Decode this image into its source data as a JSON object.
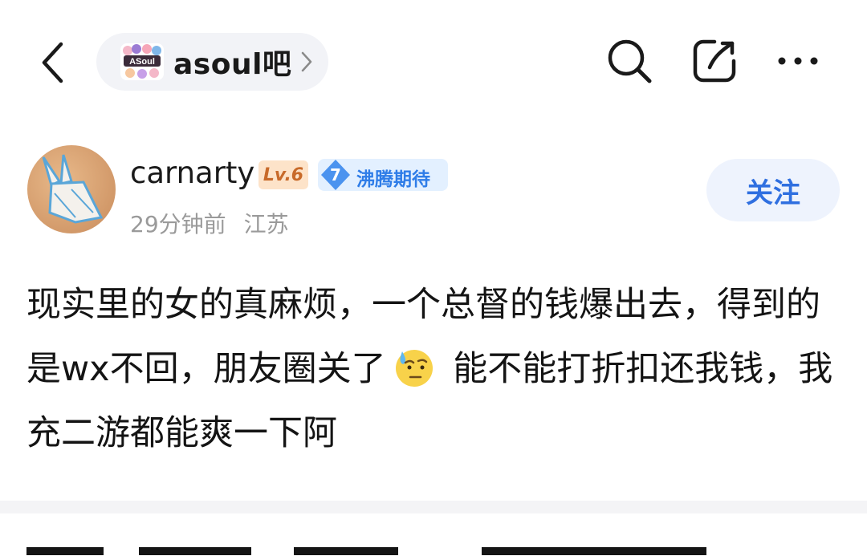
{
  "header": {
    "forum_name": "asoul吧",
    "logo_text": "ASoul",
    "icons": [
      "back-arrow-icon",
      "search-icon",
      "share-icon",
      "more-icon"
    ]
  },
  "post": {
    "author": "carnarty",
    "level": "Lv.6",
    "fan_level": "7",
    "fan_badge": "沸腾期待",
    "time": "29分钟前",
    "location": "江苏",
    "follow_label": "关注",
    "content_before": "现实里的女的真麻烦，一个总督的钱爆出去，得到的是wx不回，朋友圈关了",
    "emoji": "sweat-smile-emoji",
    "content_after": " 能不能打折扣还我钱，我充二游都能爽一下阿"
  },
  "colors": {
    "accent_blue": "#2f6fe0",
    "pill_bg": "#f2f3f7",
    "level_bg": "#fde3c9",
    "level_text": "#c86a2a"
  }
}
